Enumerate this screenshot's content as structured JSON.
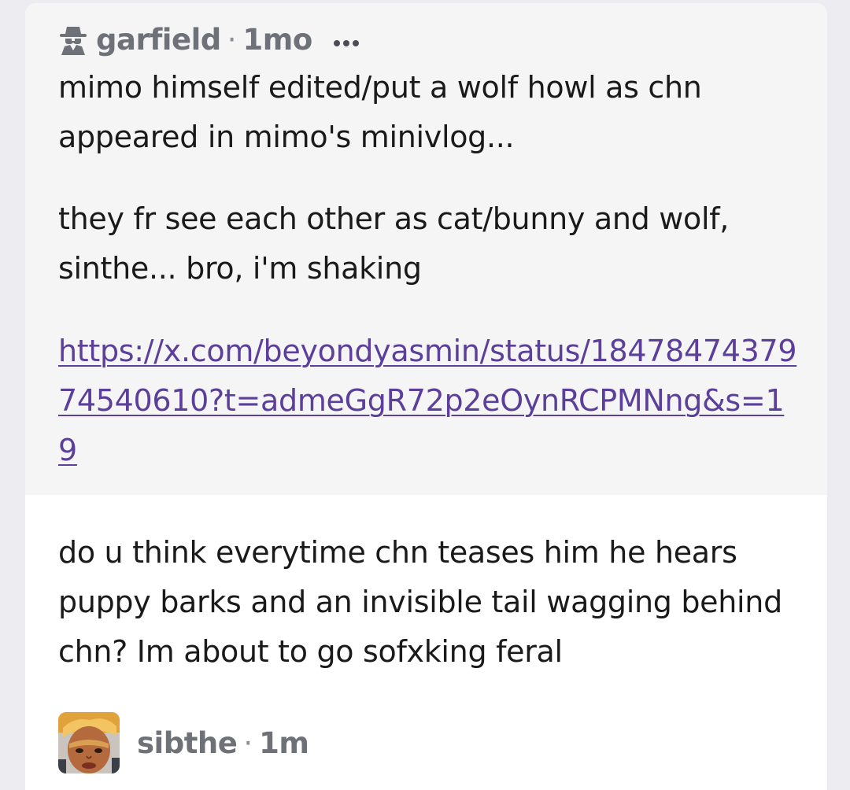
{
  "quoted_post": {
    "author": "garfield",
    "separator": "·",
    "time": "1mo",
    "author_icon": "anonymous-spy-icon",
    "more_icon": "more-dots-icon",
    "paragraph_1": "mimo himself edited/put a wolf howl as chn appeared in mimo's minivlog...",
    "paragraph_2": "they fr see each other as cat/bunny and wolf, sinthe... bro, i'm shaking",
    "link_text": "https://x.com/beyondyasmin/status/1847847437974540610?t=admeGgR72p2eOynRCPMNng&s=19",
    "link_color": "#5b3f9b"
  },
  "reply": {
    "text": "do u think everytime chn teases him he hears puppy barks and an invisible tail wagging behind chn? Im about to go sofxking feral",
    "author": "sibthe",
    "separator": "·",
    "time": "1m"
  }
}
